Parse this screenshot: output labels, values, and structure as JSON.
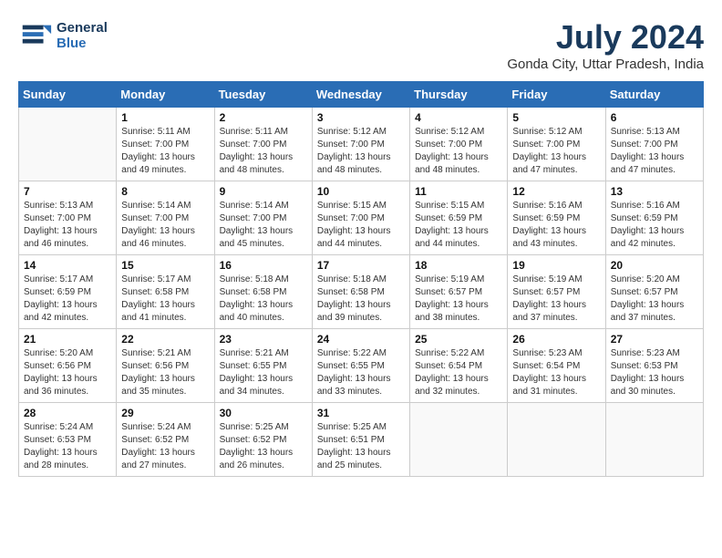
{
  "header": {
    "logo_line1": "General",
    "logo_line2": "Blue",
    "title": "July 2024",
    "location": "Gonda City, Uttar Pradesh, India"
  },
  "columns": [
    "Sunday",
    "Monday",
    "Tuesday",
    "Wednesday",
    "Thursday",
    "Friday",
    "Saturday"
  ],
  "weeks": [
    [
      {
        "day": "",
        "sunrise": "",
        "sunset": "",
        "daylight": ""
      },
      {
        "day": "1",
        "sunrise": "Sunrise: 5:11 AM",
        "sunset": "Sunset: 7:00 PM",
        "daylight": "Daylight: 13 hours and 49 minutes."
      },
      {
        "day": "2",
        "sunrise": "Sunrise: 5:11 AM",
        "sunset": "Sunset: 7:00 PM",
        "daylight": "Daylight: 13 hours and 48 minutes."
      },
      {
        "day": "3",
        "sunrise": "Sunrise: 5:12 AM",
        "sunset": "Sunset: 7:00 PM",
        "daylight": "Daylight: 13 hours and 48 minutes."
      },
      {
        "day": "4",
        "sunrise": "Sunrise: 5:12 AM",
        "sunset": "Sunset: 7:00 PM",
        "daylight": "Daylight: 13 hours and 48 minutes."
      },
      {
        "day": "5",
        "sunrise": "Sunrise: 5:12 AM",
        "sunset": "Sunset: 7:00 PM",
        "daylight": "Daylight: 13 hours and 47 minutes."
      },
      {
        "day": "6",
        "sunrise": "Sunrise: 5:13 AM",
        "sunset": "Sunset: 7:00 PM",
        "daylight": "Daylight: 13 hours and 47 minutes."
      }
    ],
    [
      {
        "day": "7",
        "sunrise": "Sunrise: 5:13 AM",
        "sunset": "Sunset: 7:00 PM",
        "daylight": "Daylight: 13 hours and 46 minutes."
      },
      {
        "day": "8",
        "sunrise": "Sunrise: 5:14 AM",
        "sunset": "Sunset: 7:00 PM",
        "daylight": "Daylight: 13 hours and 46 minutes."
      },
      {
        "day": "9",
        "sunrise": "Sunrise: 5:14 AM",
        "sunset": "Sunset: 7:00 PM",
        "daylight": "Daylight: 13 hours and 45 minutes."
      },
      {
        "day": "10",
        "sunrise": "Sunrise: 5:15 AM",
        "sunset": "Sunset: 7:00 PM",
        "daylight": "Daylight: 13 hours and 44 minutes."
      },
      {
        "day": "11",
        "sunrise": "Sunrise: 5:15 AM",
        "sunset": "Sunset: 6:59 PM",
        "daylight": "Daylight: 13 hours and 44 minutes."
      },
      {
        "day": "12",
        "sunrise": "Sunrise: 5:16 AM",
        "sunset": "Sunset: 6:59 PM",
        "daylight": "Daylight: 13 hours and 43 minutes."
      },
      {
        "day": "13",
        "sunrise": "Sunrise: 5:16 AM",
        "sunset": "Sunset: 6:59 PM",
        "daylight": "Daylight: 13 hours and 42 minutes."
      }
    ],
    [
      {
        "day": "14",
        "sunrise": "Sunrise: 5:17 AM",
        "sunset": "Sunset: 6:59 PM",
        "daylight": "Daylight: 13 hours and 42 minutes."
      },
      {
        "day": "15",
        "sunrise": "Sunrise: 5:17 AM",
        "sunset": "Sunset: 6:58 PM",
        "daylight": "Daylight: 13 hours and 41 minutes."
      },
      {
        "day": "16",
        "sunrise": "Sunrise: 5:18 AM",
        "sunset": "Sunset: 6:58 PM",
        "daylight": "Daylight: 13 hours and 40 minutes."
      },
      {
        "day": "17",
        "sunrise": "Sunrise: 5:18 AM",
        "sunset": "Sunset: 6:58 PM",
        "daylight": "Daylight: 13 hours and 39 minutes."
      },
      {
        "day": "18",
        "sunrise": "Sunrise: 5:19 AM",
        "sunset": "Sunset: 6:57 PM",
        "daylight": "Daylight: 13 hours and 38 minutes."
      },
      {
        "day": "19",
        "sunrise": "Sunrise: 5:19 AM",
        "sunset": "Sunset: 6:57 PM",
        "daylight": "Daylight: 13 hours and 37 minutes."
      },
      {
        "day": "20",
        "sunrise": "Sunrise: 5:20 AM",
        "sunset": "Sunset: 6:57 PM",
        "daylight": "Daylight: 13 hours and 37 minutes."
      }
    ],
    [
      {
        "day": "21",
        "sunrise": "Sunrise: 5:20 AM",
        "sunset": "Sunset: 6:56 PM",
        "daylight": "Daylight: 13 hours and 36 minutes."
      },
      {
        "day": "22",
        "sunrise": "Sunrise: 5:21 AM",
        "sunset": "Sunset: 6:56 PM",
        "daylight": "Daylight: 13 hours and 35 minutes."
      },
      {
        "day": "23",
        "sunrise": "Sunrise: 5:21 AM",
        "sunset": "Sunset: 6:55 PM",
        "daylight": "Daylight: 13 hours and 34 minutes."
      },
      {
        "day": "24",
        "sunrise": "Sunrise: 5:22 AM",
        "sunset": "Sunset: 6:55 PM",
        "daylight": "Daylight: 13 hours and 33 minutes."
      },
      {
        "day": "25",
        "sunrise": "Sunrise: 5:22 AM",
        "sunset": "Sunset: 6:54 PM",
        "daylight": "Daylight: 13 hours and 32 minutes."
      },
      {
        "day": "26",
        "sunrise": "Sunrise: 5:23 AM",
        "sunset": "Sunset: 6:54 PM",
        "daylight": "Daylight: 13 hours and 31 minutes."
      },
      {
        "day": "27",
        "sunrise": "Sunrise: 5:23 AM",
        "sunset": "Sunset: 6:53 PM",
        "daylight": "Daylight: 13 hours and 30 minutes."
      }
    ],
    [
      {
        "day": "28",
        "sunrise": "Sunrise: 5:24 AM",
        "sunset": "Sunset: 6:53 PM",
        "daylight": "Daylight: 13 hours and 28 minutes."
      },
      {
        "day": "29",
        "sunrise": "Sunrise: 5:24 AM",
        "sunset": "Sunset: 6:52 PM",
        "daylight": "Daylight: 13 hours and 27 minutes."
      },
      {
        "day": "30",
        "sunrise": "Sunrise: 5:25 AM",
        "sunset": "Sunset: 6:52 PM",
        "daylight": "Daylight: 13 hours and 26 minutes."
      },
      {
        "day": "31",
        "sunrise": "Sunrise: 5:25 AM",
        "sunset": "Sunset: 6:51 PM",
        "daylight": "Daylight: 13 hours and 25 minutes."
      },
      {
        "day": "",
        "sunrise": "",
        "sunset": "",
        "daylight": ""
      },
      {
        "day": "",
        "sunrise": "",
        "sunset": "",
        "daylight": ""
      },
      {
        "day": "",
        "sunrise": "",
        "sunset": "",
        "daylight": ""
      }
    ]
  ]
}
